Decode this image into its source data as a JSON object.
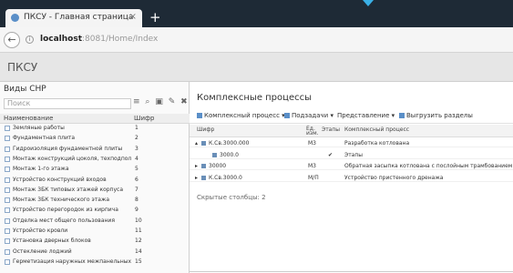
{
  "browser": {
    "tab_title": "ПКСУ - Главная страница",
    "tab_close": "×",
    "new_tab": "+",
    "url_host": "localhost",
    "url_path": ":8081/Home/Index",
    "back_icon": "arrow-left-icon",
    "info_icon": "info-icon"
  },
  "app": {
    "brand": "ПКСУ"
  },
  "left_panel": {
    "title": "Виды СНР",
    "search_placeholder": "Поиск",
    "tools": [
      "≡",
      "⌕",
      "▣",
      "✎",
      "✖",
      "↑"
    ],
    "col_name": "Наименование",
    "col_code": "Шифр",
    "rows": [
      {
        "name": "Земляные работы",
        "code": "1"
      },
      {
        "name": "Фундаментная плита",
        "code": "2"
      },
      {
        "name": "Гидроизоляция фундаментной плиты",
        "code": "3"
      },
      {
        "name": "Монтаж конструкций цоколя, техподполья",
        "code": "4"
      },
      {
        "name": "Монтаж 1-го этажа",
        "code": "5"
      },
      {
        "name": "Устройство конструкций входов",
        "code": "6"
      },
      {
        "name": "Монтаж 3БК типовых этажей корпуса",
        "code": "7"
      },
      {
        "name": "Монтаж 3БК технического этажа",
        "code": "8"
      },
      {
        "name": "Устройство перегородок из кирпича",
        "code": "9"
      },
      {
        "name": "Отделка мест общего пользования",
        "code": "10"
      },
      {
        "name": "Устройство кровли",
        "code": "11"
      },
      {
        "name": "Установка дверных блоков",
        "code": "12"
      },
      {
        "name": "Остекление лоджий",
        "code": "14"
      },
      {
        "name": "Герметизация наружных межпанельных швов",
        "code": "15"
      }
    ]
  },
  "main": {
    "title": "Комплексные процессы",
    "toolbar": {
      "complex": "Комплексный процесс ▾",
      "subtask": "Подзадачи ▾",
      "view": "Представление ▾",
      "export": "Выгрузить разделы"
    },
    "columns": {
      "code": "Шифр",
      "unit": "Ед. изм.",
      "stages": "Этапы",
      "process": "Комплексный процесс"
    },
    "rows": [
      {
        "code": "К.Св.3000.000",
        "unit": "М3",
        "stage": "",
        "process": "Разработка котлована",
        "indent": 0,
        "expanded": "▴"
      },
      {
        "code": "3000.0",
        "unit": "",
        "stage": "✔",
        "process": "Этапы",
        "indent": 1,
        "expanded": ""
      },
      {
        "code": "30000",
        "unit": "М3",
        "stage": "",
        "process": "Обратная засыпка котлована с послойным трамбованием",
        "indent": 0,
        "expanded": "▸"
      },
      {
        "code": "К.Св.3000.0",
        "unit": "М/П",
        "stage": "",
        "process": "Устройство пристенного дренажа",
        "indent": 0,
        "expanded": "▸"
      }
    ],
    "footer": "Скрытые столбцы: 2"
  }
}
